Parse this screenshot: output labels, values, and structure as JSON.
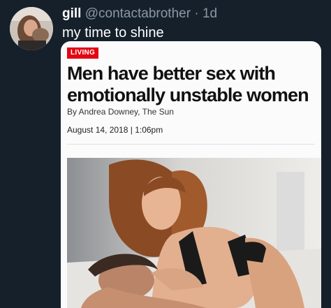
{
  "tweet": {
    "display_name": "gill",
    "handle": "@contactabrother",
    "separator": " · ",
    "timestamp": "1d",
    "text": "my time to shine"
  },
  "article": {
    "section_tag": "LIVING",
    "headline": "Men have better sex with emotionally unstable women",
    "byline": "By Andrea Downey, The Sun",
    "dateline": "August 14, 2018 | 1:06pm"
  },
  "colors": {
    "background": "#15202b",
    "muted_text": "#8b98a5",
    "tag_red": "#e30613"
  }
}
